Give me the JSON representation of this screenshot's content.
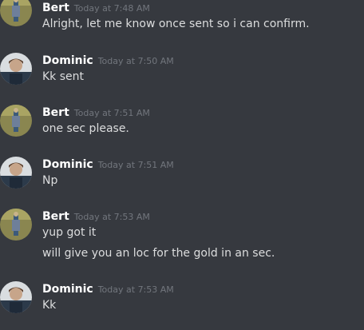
{
  "messages": [
    {
      "author": "Bert",
      "timestamp": "Today at 7:48 AM",
      "avatar_icon": "bert-avatar-icon",
      "lines": [
        "Alright, let me know once sent so i can confirm."
      ]
    },
    {
      "author": "Dominic",
      "timestamp": "Today at 7:50 AM",
      "avatar_icon": "dominic-avatar-icon",
      "lines": [
        "Kk sent"
      ]
    },
    {
      "author": "Bert",
      "timestamp": "Today at 7:51 AM",
      "avatar_icon": "bert-avatar-icon",
      "lines": [
        "one sec please."
      ]
    },
    {
      "author": "Dominic",
      "timestamp": "Today at 7:51 AM",
      "avatar_icon": "dominic-avatar-icon",
      "lines": [
        "Np"
      ]
    },
    {
      "author": "Bert",
      "timestamp": "Today at 7:53 AM",
      "avatar_icon": "bert-avatar-icon",
      "lines": [
        "yup got it",
        "will give you an loc for the gold in an sec."
      ]
    },
    {
      "author": "Dominic",
      "timestamp": "Today at 7:53 AM",
      "avatar_icon": "dominic-avatar-icon",
      "lines": [
        "Kk"
      ]
    }
  ],
  "colors": {
    "background": "#36393f",
    "username": "#ffffff",
    "timestamp": "#72767d",
    "message_text": "#dcddde"
  }
}
